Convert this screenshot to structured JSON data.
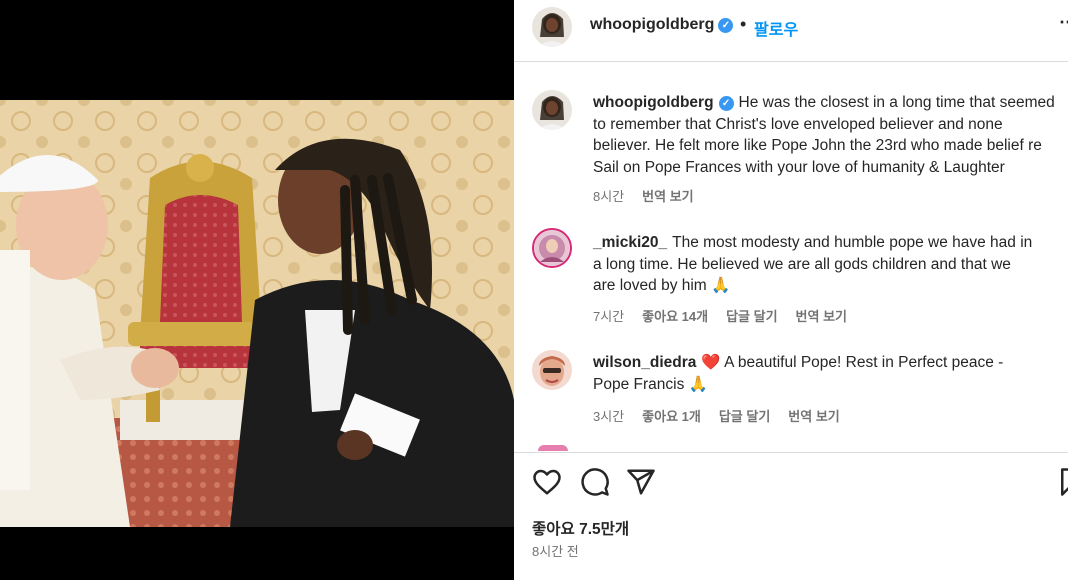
{
  "header": {
    "username": "whoopigoldberg",
    "verified_icon": "verified-badge-icon",
    "separator": "•",
    "follow_label": "팔로우",
    "more_label": "⋯"
  },
  "caption": {
    "username": "whoopigoldberg",
    "lines": [
      "He was the closest in a long time that seemed",
      "to remember that Christ's love enveloped believer and none",
      "believer. He felt more like Pope John the 23rd who made belief re",
      "Sail on Pope Frances with your love of humanity & Laughter"
    ],
    "time": "8시간",
    "translate_label": "번역 보기"
  },
  "comments": [
    {
      "username": "_micki20_",
      "lines": [
        "The most modesty and humble pope we have had in",
        "a long time. He believed we are all gods children and that we",
        "are loved by him 🙏"
      ],
      "time": "7시간",
      "likes": "좋아요 14개",
      "reply_label": "답글 달기",
      "translate_label": "번역 보기"
    },
    {
      "username": "wilson_diedra",
      "lines": [
        "❤️ A beautiful Pope! Rest in Perfect peace -",
        "Pope Francis 🙏"
      ],
      "time": "3시간",
      "likes": "좋아요 1개",
      "reply_label": "답글 달기",
      "translate_label": "번역 보기"
    }
  ],
  "actions": {
    "icons": [
      "heart-icon",
      "comment-icon",
      "share-icon",
      "bookmark-icon"
    ],
    "likes_text": "좋아요 7.5만개",
    "posted_time": "8시간 전"
  },
  "colors": {
    "accent": "#0095f6",
    "verified": "#3897f0",
    "text": "#262626",
    "muted": "#737373",
    "border": "#dbdbdb"
  }
}
